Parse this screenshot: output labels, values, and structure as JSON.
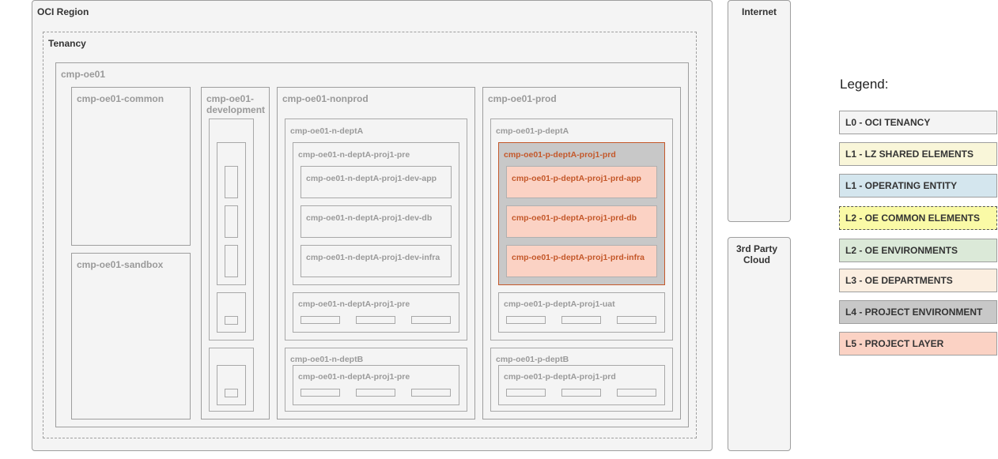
{
  "region": {
    "label": "OCI Region"
  },
  "tenancy": {
    "label": "Tenancy"
  },
  "internet": {
    "label": "Internet"
  },
  "third_party": {
    "line1": "3rd Party",
    "line2": "Cloud"
  },
  "oe": {
    "label": "cmp-oe01"
  },
  "common": {
    "label": "cmp-oe01-common"
  },
  "sandbox": {
    "label": "cmp-oe01-sandbox"
  },
  "development": {
    "line1": "cmp-oe01-",
    "line2": "development"
  },
  "nonprod": {
    "label": "cmp-oe01-nonprod",
    "deptA": {
      "label": "cmp-oe01-n-deptA",
      "proj_pre": {
        "label": "cmp-oe01-n-deptA-proj1-pre",
        "layers": [
          "cmp-oe01-n-deptA-proj1-dev-app",
          "cmp-oe01-n-deptA-proj1-dev-db",
          "cmp-oe01-n-deptA-proj1-dev-infra"
        ]
      },
      "proj_pre2": {
        "label": "cmp-oe01-n-deptA-proj1-pre"
      }
    },
    "deptB": {
      "label": "cmp-oe01-n-deptB",
      "proj": {
        "label": "cmp-oe01-n-deptA-proj1-pre"
      }
    }
  },
  "prod": {
    "label": "cmp-oe01-prod",
    "deptA": {
      "label": "cmp-oe01-p-deptA",
      "proj_prd": {
        "label": "cmp-oe01-p-deptA-proj1-prd",
        "layers": [
          "cmp-oe01-p-deptA-proj1-prd-app",
          "cmp-oe01-p-deptA-proj1-prd-db",
          "cmp-oe01-p-deptA-proj1-prd-infra"
        ]
      },
      "proj_uat": {
        "label": "cmp-oe01-p-deptA-proj1-uat"
      }
    },
    "deptB": {
      "label": "cmp-oe01-p-deptB",
      "proj": {
        "label": "cmp-oe01-p-deptA-proj1-prd"
      }
    }
  },
  "legend": {
    "title": "Legend:",
    "items": [
      {
        "label": "L0 - OCI TENANCY",
        "color": "#f4f4f4"
      },
      {
        "label": "L1 - LZ SHARED ELEMENTS",
        "color": "#f9f6d9"
      },
      {
        "label": "L1 - OPERATING ENTITY",
        "color": "#d4e6ee"
      },
      {
        "label": "L2 - OE COMMON ELEMENTS",
        "color": "#fafaa6"
      },
      {
        "label": "L2 - OE ENVIRONMENTS",
        "color": "#dbe9d8"
      },
      {
        "label": "L3 - OE DEPARTMENTS",
        "color": "#fbeee0"
      },
      {
        "label": "L4 - PROJECT ENVIRONMENT",
        "color": "#c8c8c8"
      },
      {
        "label": "L5 - PROJECT LAYER",
        "color": "#fbd2c4"
      }
    ]
  }
}
